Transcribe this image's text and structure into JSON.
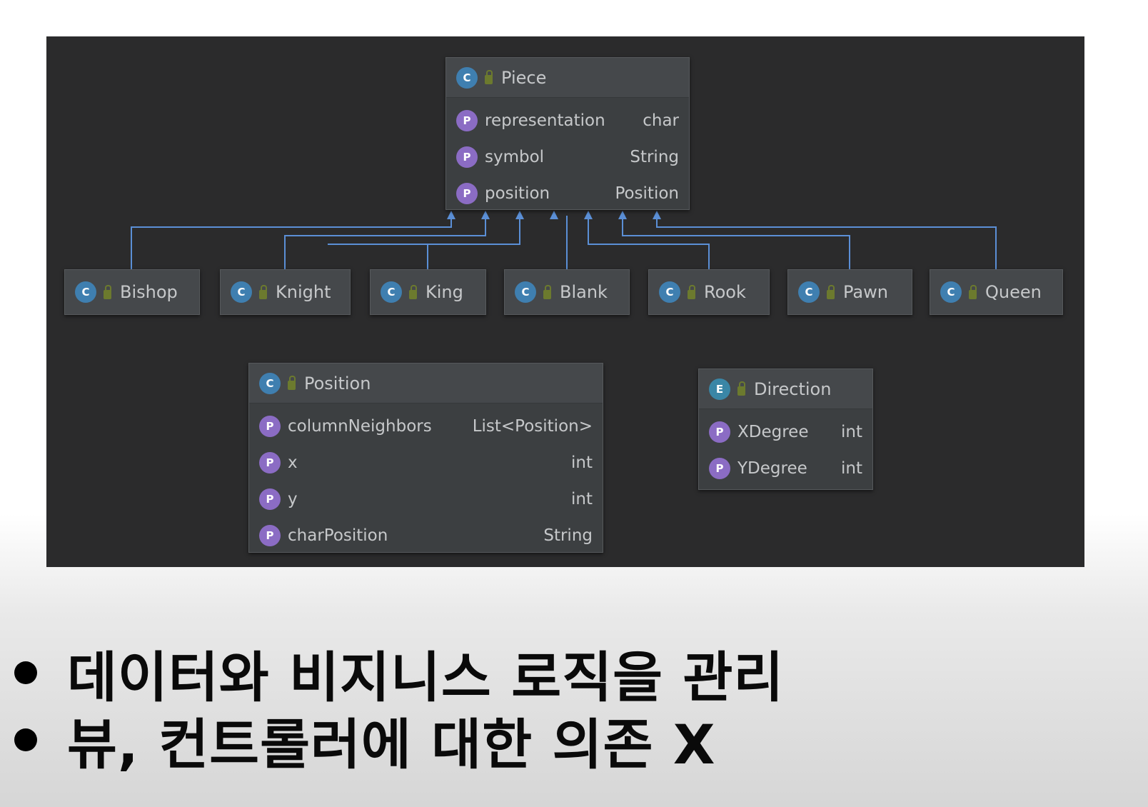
{
  "diagram": {
    "background": "#2b2b2c",
    "edge_color": "#5b8fd6",
    "parent": {
      "id": "piece",
      "title": "Piece",
      "kind": "class",
      "fields": [
        {
          "name": "representation",
          "type": "char"
        },
        {
          "name": "symbol",
          "type": "String"
        },
        {
          "name": "position",
          "type": "Position"
        }
      ]
    },
    "subclasses": [
      {
        "id": "bishop",
        "title": "Bishop"
      },
      {
        "id": "knight",
        "title": "Knight"
      },
      {
        "id": "king",
        "title": "King"
      },
      {
        "id": "blank",
        "title": "Blank"
      },
      {
        "id": "rook",
        "title": "Rook"
      },
      {
        "id": "pawn",
        "title": "Pawn"
      },
      {
        "id": "queen",
        "title": "Queen"
      }
    ],
    "position_class": {
      "title": "Position",
      "kind": "class",
      "fields": [
        {
          "name": "columnNeighbors",
          "type": "List<Position>"
        },
        {
          "name": "x",
          "type": "int"
        },
        {
          "name": "y",
          "type": "int"
        },
        {
          "name": "charPosition",
          "type": "String"
        }
      ]
    },
    "direction_enum": {
      "title": "Direction",
      "kind": "enum",
      "fields": [
        {
          "name": "XDegree",
          "type": "int"
        },
        {
          "name": "YDegree",
          "type": "int"
        }
      ]
    },
    "badges": {
      "class": "C",
      "enum": "E",
      "field": "P"
    },
    "edges": [
      {
        "from": "bishop",
        "to": "piece",
        "type": "inheritance"
      },
      {
        "from": "knight",
        "to": "piece",
        "type": "inheritance"
      },
      {
        "from": "king",
        "to": "piece",
        "type": "inheritance"
      },
      {
        "from": "blank",
        "to": "piece",
        "type": "inheritance"
      },
      {
        "from": "rook",
        "to": "piece",
        "type": "inheritance"
      },
      {
        "from": "pawn",
        "to": "piece",
        "type": "inheritance"
      },
      {
        "from": "queen",
        "to": "piece",
        "type": "inheritance"
      }
    ]
  },
  "bullets": [
    {
      "text": "데이터와 비지니스 로직을 관리"
    },
    {
      "text": "뷰, 컨트롤러에 대한 의존 X"
    }
  ]
}
